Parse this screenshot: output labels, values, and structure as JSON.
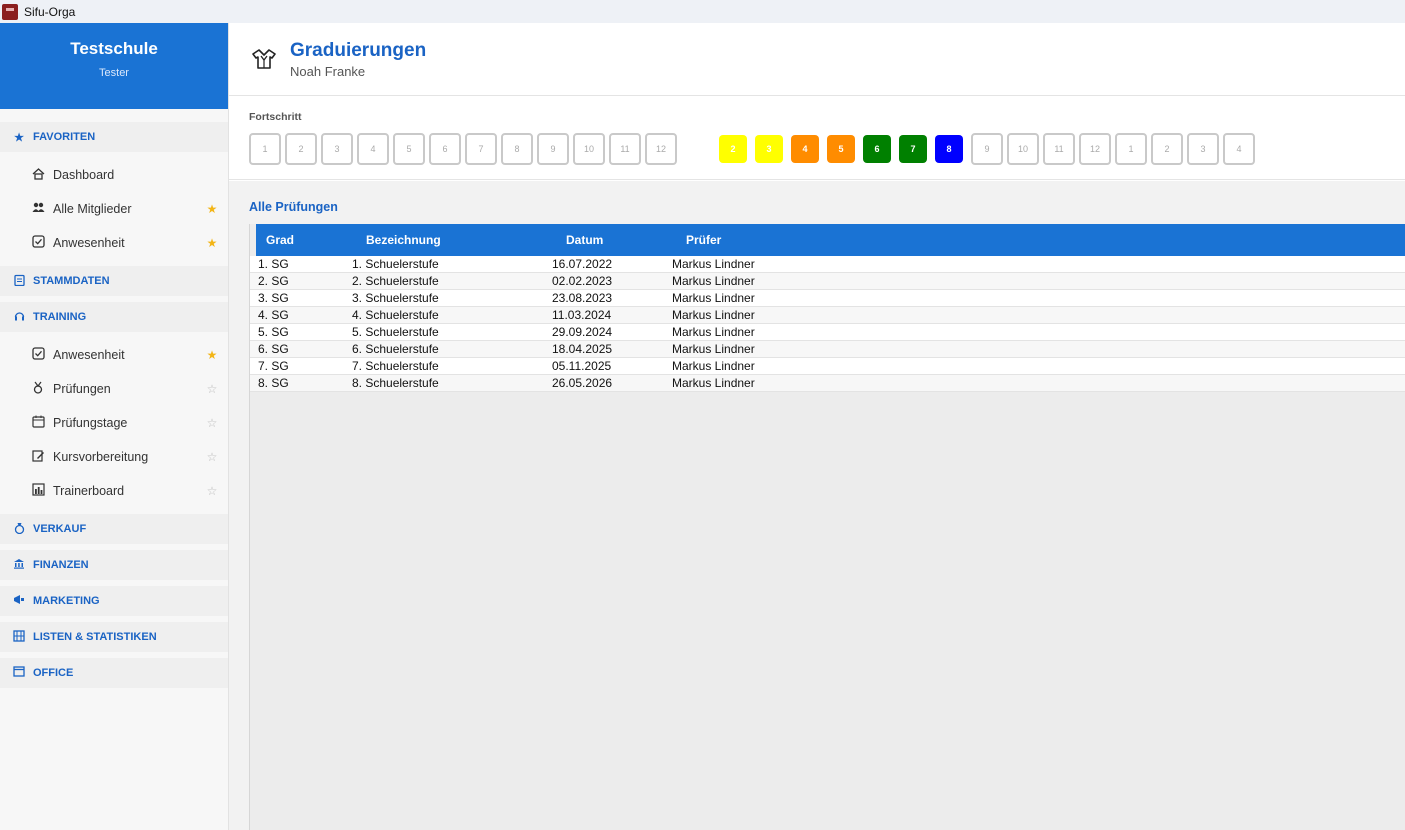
{
  "window": {
    "title": "Sifu-Orga"
  },
  "sidebar": {
    "school": "Testschule",
    "user": "Tester",
    "favorites": {
      "title": "FAVORITEN",
      "items": [
        {
          "label": "Dashboard",
          "icon": "house-icon",
          "star": ""
        },
        {
          "label": "Alle Mitglieder",
          "icon": "people-icon",
          "star": "★"
        },
        {
          "label": "Anwesenheit",
          "icon": "checkbox-icon",
          "star": "★"
        }
      ]
    },
    "stammdaten": {
      "title": "STAMMDATEN"
    },
    "training": {
      "title": "TRAINING",
      "items": [
        {
          "label": "Anwesenheit",
          "icon": "checkbox-icon",
          "star": "★"
        },
        {
          "label": "Prüfungen",
          "icon": "medal-icon",
          "star": "☆"
        },
        {
          "label": "Prüfungstage",
          "icon": "calendar-icon",
          "star": "☆"
        },
        {
          "label": "Kursvorbereitung",
          "icon": "edit-icon",
          "star": "☆"
        },
        {
          "label": "Trainerboard",
          "icon": "chart-icon",
          "star": "☆"
        }
      ]
    },
    "verkauf": {
      "title": "VERKAUF"
    },
    "finanzen": {
      "title": "FINANZEN"
    },
    "marketing": {
      "title": "MARKETING"
    },
    "listen": {
      "title": "LISTEN & STATISTIKEN"
    },
    "office": {
      "title": "OFFICE"
    }
  },
  "header": {
    "title": "Graduierungen",
    "subtitle": "Noah Franke"
  },
  "progress": {
    "label": "Fortschritt",
    "row1": [
      "1",
      "2",
      "3",
      "4",
      "5",
      "6",
      "7",
      "8",
      "9",
      "10",
      "11",
      "12"
    ],
    "row2": [
      {
        "label": "2",
        "color": "#ffff00"
      },
      {
        "label": "3",
        "color": "#ffff00"
      },
      {
        "label": "4",
        "color": "#ff8c00"
      },
      {
        "label": "5",
        "color": "#ff8c00"
      },
      {
        "label": "6",
        "color": "#008000"
      },
      {
        "label": "7",
        "color": "#008000"
      },
      {
        "label": "8",
        "color": "#0000ff"
      },
      {
        "label": "9",
        "color": ""
      },
      {
        "label": "10",
        "color": ""
      },
      {
        "label": "11",
        "color": ""
      },
      {
        "label": "12",
        "color": ""
      },
      {
        "label": "1",
        "color": ""
      },
      {
        "label": "2",
        "color": ""
      },
      {
        "label": "3",
        "color": ""
      },
      {
        "label": "4",
        "color": ""
      }
    ]
  },
  "exams": {
    "title": "Alle Prüfungen",
    "columns": [
      "Grad",
      "Bezeichnung",
      "Datum",
      "Prüfer"
    ],
    "rows": [
      [
        "1. SG",
        "1. Schuelerstufe",
        "16.07.2022",
        "Markus Lindner"
      ],
      [
        "2. SG",
        "2. Schuelerstufe",
        "02.02.2023",
        "Markus Lindner"
      ],
      [
        "3. SG",
        "3. Schuelerstufe",
        "23.08.2023",
        "Markus Lindner"
      ],
      [
        "4. SG",
        "4. Schuelerstufe",
        "11.03.2024",
        "Markus Lindner"
      ],
      [
        "5. SG",
        "5. Schuelerstufe",
        "29.09.2024",
        "Markus Lindner"
      ],
      [
        "6. SG",
        "6. Schuelerstufe",
        "18.04.2025",
        "Markus Lindner"
      ],
      [
        "7. SG",
        "7. Schuelerstufe",
        "05.11.2025",
        "Markus Lindner"
      ],
      [
        "8. SG",
        "8. Schuelerstufe",
        "26.05.2026",
        "Markus Lindner"
      ]
    ]
  }
}
